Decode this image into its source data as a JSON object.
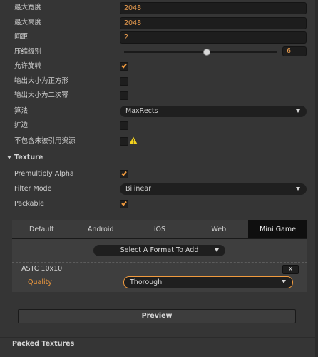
{
  "settings": {
    "max_width_label": "最大宽度",
    "max_width_value": "2048",
    "max_height_label": "最大高度",
    "max_height_value": "2048",
    "padding_label": "间距",
    "padding_value": "2",
    "compression_label": "压缩级别",
    "compression_value": "6",
    "compression_level": 0.54,
    "allow_rotation_label": "允许旋转",
    "allow_rotation": true,
    "square_label": "输出大小为正方形",
    "square": false,
    "pot_label": "输出大小为二次幂",
    "pot": false,
    "algorithm_label": "算法",
    "algorithm_value": "MaxRects",
    "extrude_label": "扩边",
    "extrude": false,
    "exclude_unref_label": "不包含未被引用资源",
    "exclude_unref": false
  },
  "texture": {
    "section_label": "Texture",
    "premultiply_label": "Premultiply Alpha",
    "premultiply": true,
    "filter_label": "Filter Mode",
    "filter_value": "Bilinear",
    "packable_label": "Packable",
    "packable": true
  },
  "platform_tabs": [
    "Default",
    "Android",
    "iOS",
    "Web",
    "Mini Game"
  ],
  "active_tab": "Mini Game",
  "format": {
    "select_placeholder": "Select A Format To Add",
    "format_name": "ASTC 10x10",
    "remove_label": "x",
    "quality_label": "Quality",
    "quality_value": "Thorough"
  },
  "preview_label": "Preview",
  "packed_textures_label": "Packed Textures",
  "colors": {
    "accent": "#f09a3e",
    "warning": "#f3d21e"
  }
}
